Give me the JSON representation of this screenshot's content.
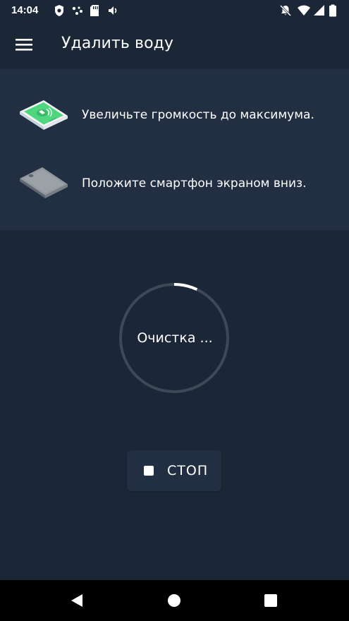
{
  "status_bar": {
    "time": "14:04",
    "left_icons": [
      "shield-icon",
      "assistant-dots-icon",
      "sd-card-icon",
      "volume-icon"
    ],
    "right_icons": [
      "notifications-off-icon",
      "wifi-icon",
      "signal-icon",
      "battery-icon"
    ]
  },
  "app_bar": {
    "title": "Удалить воду",
    "menu_icon": "hamburger-menu-icon"
  },
  "instructions": [
    {
      "icon": "phone-volume-illustration",
      "text": "Увеличьте громкость до максимума."
    },
    {
      "icon": "phone-face-down-illustration",
      "text": "Положите смартфон экраном вниз."
    }
  ],
  "progress": {
    "label": "Очистка ...",
    "fraction": 0.07
  },
  "stop_button": {
    "label": "СТОП",
    "icon": "stop-icon"
  },
  "nav_bar": {
    "buttons": [
      "back-icon",
      "home-icon",
      "recents-icon"
    ]
  },
  "colors": {
    "background": "#1b2737",
    "panel": "#222f42",
    "accent_green": "#4fd67f",
    "ring_track": "#3e4958",
    "ring_progress": "#ffffff"
  }
}
